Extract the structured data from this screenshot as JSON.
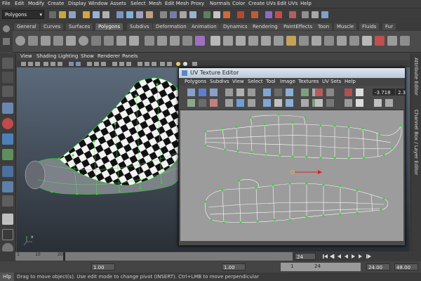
{
  "menubar": [
    "File",
    "Edit",
    "Modify",
    "Create",
    "Display",
    "Window",
    "Assets",
    "Select",
    "Mesh",
    "Edit Mesh",
    "Proxy",
    "Normals",
    "Color",
    "Create UVs",
    "Edit UVs",
    "Help"
  ],
  "statusline": {
    "mode": "Polygons"
  },
  "shelf_tabs": [
    "General",
    "Curves",
    "Surfaces",
    "Polygons",
    "Subdivs",
    "Deformation",
    "Animation",
    "Dynamics",
    "Rendering",
    "PaintEffects",
    "Toon",
    "Muscle",
    "Fluids",
    "Fur"
  ],
  "active_shelf_tab": "Polygons",
  "viewport_menu": [
    "View",
    "Shading",
    "Lighting",
    "Show",
    "Renderer",
    "Panels"
  ],
  "uv_editor": {
    "title": "UV Texture Editor",
    "menu": [
      "Polygons",
      "Subdivs",
      "View",
      "Select",
      "Tool",
      "Image",
      "Textures",
      "UV Sets",
      "Help"
    ],
    "coord_value": "-3.718",
    "coord_value2": "2.3"
  },
  "side_panels": [
    "Attribute Editor",
    "Channel Box / Layer Editor"
  ],
  "time_slider": {
    "ticks": [
      "1",
      "10",
      "20"
    ],
    "current_frame": "24"
  },
  "range": {
    "start": "1.00",
    "start2": "1.00",
    "slider_start": "1",
    "slider_end": "24",
    "end": "24.00",
    "end2": "48.00"
  },
  "help_line": {
    "label": "Hlp",
    "message": "Drag to move object(s). Use edit mode to change pivot (INSERT).  Ctrl+LMB to move perpendicular"
  },
  "colors": {
    "uv_vertex": "#22dd22",
    "uv_edge": "#ffffff",
    "manip_x": "#e02020"
  }
}
